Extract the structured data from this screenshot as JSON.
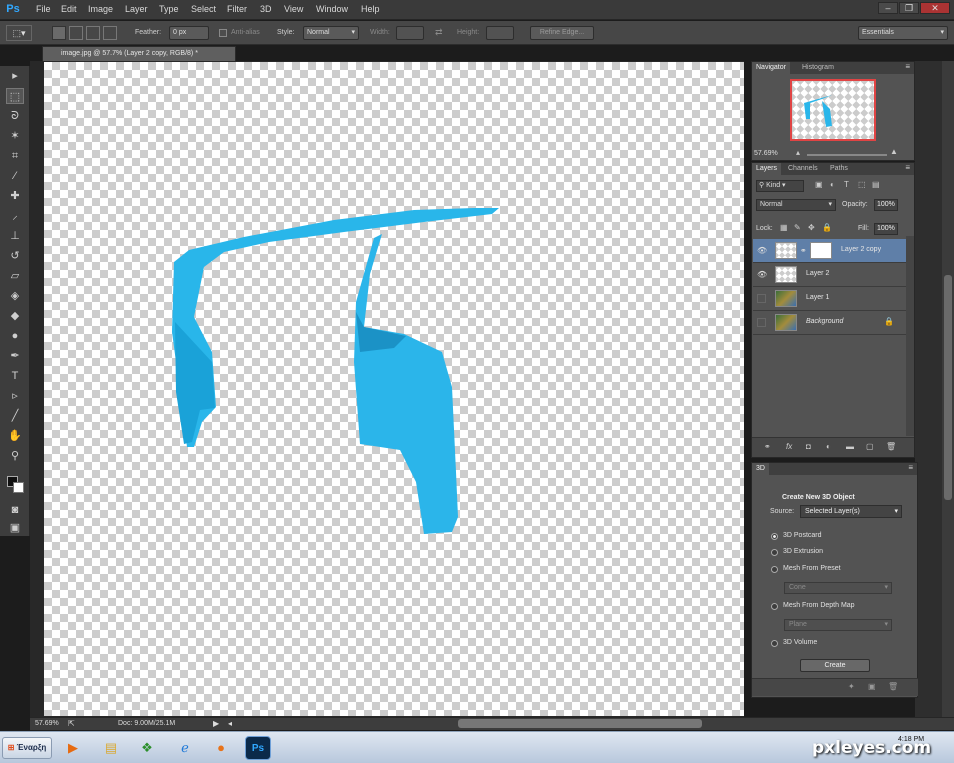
{
  "app": {
    "logo": "Ps"
  },
  "menu": [
    "File",
    "Edit",
    "Image",
    "Layer",
    "Type",
    "Select",
    "Filter",
    "3D",
    "View",
    "Window",
    "Help"
  ],
  "window_controls": {
    "minimize": "–",
    "restore": "❐",
    "close": "✕"
  },
  "options": {
    "feather_label": "Feather:",
    "feather_value": "0 px",
    "antialias_label": "Anti-alias",
    "style_label": "Style:",
    "style_value": "Normal",
    "width_label": "Width:",
    "height_label": "Height:",
    "refine_label": "Refine Edge...",
    "workspace": "Essentials"
  },
  "document": {
    "tab_title": "image.jpg @ 57.7% (Layer 2 copy, RGB/8) *"
  },
  "navigator": {
    "tabs": [
      "Navigator",
      "Histogram"
    ],
    "zoom": "57.69%"
  },
  "layers": {
    "tabs": [
      "Layers",
      "Channels",
      "Paths"
    ],
    "filter_kind": "Kind",
    "blend_mode": "Normal",
    "opacity_label": "Opacity:",
    "opacity_value": "100%",
    "lock_label": "Lock:",
    "fill_label": "Fill:",
    "fill_value": "100%",
    "items": [
      {
        "name": "Layer 2 copy",
        "visible": true,
        "selected": true
      },
      {
        "name": "Layer 2",
        "visible": true,
        "selected": false
      },
      {
        "name": "Layer 1",
        "visible": false,
        "selected": false
      },
      {
        "name": "Background",
        "visible": false,
        "selected": false,
        "locked": true
      }
    ]
  },
  "panel3d": {
    "tab": "3D",
    "title": "Create New 3D Object",
    "source_label": "Source:",
    "source_value": "Selected Layer(s)",
    "options": [
      "3D Postcard",
      "3D Extrusion",
      "Mesh From Preset",
      "Mesh From Depth Map",
      "3D Volume"
    ],
    "selected_option": "3D Postcard",
    "preset_value": "Cone",
    "depth_value": "Plane",
    "create_label": "Create"
  },
  "status": {
    "zoom": "57.69%",
    "doc": "Doc: 9.00M/25.1M"
  },
  "taskbar": {
    "start": "Έναρξη",
    "time": "4:18 PM"
  },
  "watermark": "pxleyes.com",
  "colors": {
    "accent": "#31a8ff",
    "shape_blue": "#29b6ea",
    "selection": "#5f7fa8"
  }
}
